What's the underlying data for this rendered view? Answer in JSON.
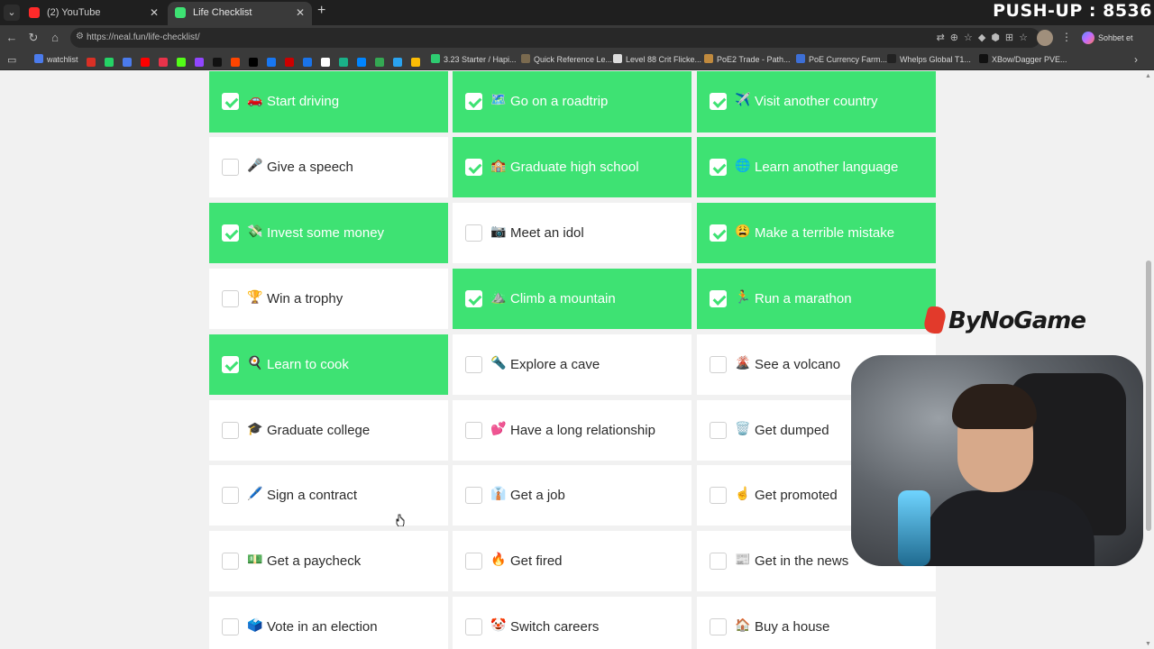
{
  "browser": {
    "tabs": [
      {
        "title": "(2) YouTube",
        "favicon_color": "#ff2a2a",
        "active": false
      },
      {
        "title": "Life Checklist",
        "favicon_color": "#3ee273",
        "active": true
      }
    ],
    "url": "https://neal.fun/life-checklist/",
    "profile_button": "Sohbet et",
    "bookmarks": [
      {
        "label": "watchlist",
        "color": "#4b7bec"
      },
      {
        "label": "3.23 Starter / Hapi...",
        "color": "#2ecc71"
      },
      {
        "label": "Quick Reference Le...",
        "color": "#7a6a4f"
      },
      {
        "label": "Level 88 Crit Flicke...",
        "color": "#dddddd"
      },
      {
        "label": "PoE2 Trade - Path...",
        "color": "#c08a3e"
      },
      {
        "label": "PoE Currency Farm...",
        "color": "#3d6fd6"
      },
      {
        "label": "Whelps Global T1...",
        "color": "#222222"
      },
      {
        "label": "XBow/Dagger PVE...",
        "color": "#111111"
      }
    ]
  },
  "overlay": {
    "counter": "PUSH-UP : 8536",
    "brand": "ByNoGame"
  },
  "checklist": {
    "items": [
      {
        "emoji": "🚗",
        "label": "Start driving",
        "checked": true
      },
      {
        "emoji": "🗺️",
        "label": "Go on a roadtrip",
        "checked": true
      },
      {
        "emoji": "✈️",
        "label": "Visit another country",
        "checked": true
      },
      {
        "emoji": "🎤",
        "label": "Give a speech",
        "checked": false
      },
      {
        "emoji": "🏫",
        "label": "Graduate high school",
        "checked": true
      },
      {
        "emoji": "🌐",
        "label": "Learn another language",
        "checked": true
      },
      {
        "emoji": "💸",
        "label": "Invest some money",
        "checked": true
      },
      {
        "emoji": "📷",
        "label": "Meet an idol",
        "checked": false
      },
      {
        "emoji": "😩",
        "label": "Make a terrible mistake",
        "checked": true
      },
      {
        "emoji": "🏆",
        "label": "Win a trophy",
        "checked": false
      },
      {
        "emoji": "⛰️",
        "label": "Climb a mountain",
        "checked": true
      },
      {
        "emoji": "🏃",
        "label": "Run a marathon",
        "checked": true
      },
      {
        "emoji": "🍳",
        "label": "Learn to cook",
        "checked": true
      },
      {
        "emoji": "🔦",
        "label": "Explore a cave",
        "checked": false
      },
      {
        "emoji": "🌋",
        "label": "See a volcano",
        "checked": false
      },
      {
        "emoji": "🎓",
        "label": "Graduate college",
        "checked": false
      },
      {
        "emoji": "💕",
        "label": "Have a long relationship",
        "checked": false
      },
      {
        "emoji": "🗑️",
        "label": "Get dumped",
        "checked": false
      },
      {
        "emoji": "🖊️",
        "label": "Sign a contract",
        "checked": false
      },
      {
        "emoji": "👔",
        "label": "Get a job",
        "checked": false
      },
      {
        "emoji": "☝️",
        "label": "Get promoted",
        "checked": false
      },
      {
        "emoji": "💵",
        "label": "Get a paycheck",
        "checked": false
      },
      {
        "emoji": "🔥",
        "label": "Get fired",
        "checked": false
      },
      {
        "emoji": "📰",
        "label": "Get in the news",
        "checked": false
      },
      {
        "emoji": "🗳️",
        "label": "Vote in an election",
        "checked": false
      },
      {
        "emoji": "🤡",
        "label": "Switch careers",
        "checked": false
      },
      {
        "emoji": "🏠",
        "label": "Buy a house",
        "checked": false
      }
    ]
  },
  "colors": {
    "checked": "#3ee273",
    "unchecked": "#ffffff",
    "page_bg": "#f1f1f1"
  }
}
